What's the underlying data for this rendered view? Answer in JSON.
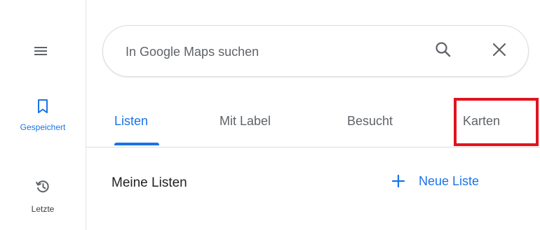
{
  "rail": {
    "menu_icon": "hamburger-menu-icon",
    "items": [
      {
        "label": "Gespeichert",
        "icon": "bookmark-icon",
        "active": true
      },
      {
        "label": "Letzte",
        "icon": "history-icon",
        "active": false
      }
    ]
  },
  "search": {
    "placeholder": "In Google Maps suchen",
    "value": "",
    "search_icon": "search-icon",
    "clear_icon": "close-icon"
  },
  "tabs": [
    {
      "label": "Listen",
      "active": true
    },
    {
      "label": "Mit Label",
      "active": false
    },
    {
      "label": "Besucht",
      "active": false
    },
    {
      "label": "Karten",
      "active": false,
      "highlighted": true
    }
  ],
  "lists_section": {
    "title": "Meine Listen",
    "new_list_label": "Neue Liste",
    "new_list_icon": "plus-icon"
  },
  "colors": {
    "accent": "#1a73e8",
    "highlight": "#e0141e",
    "text": "#202124",
    "muted": "#5f6368"
  }
}
